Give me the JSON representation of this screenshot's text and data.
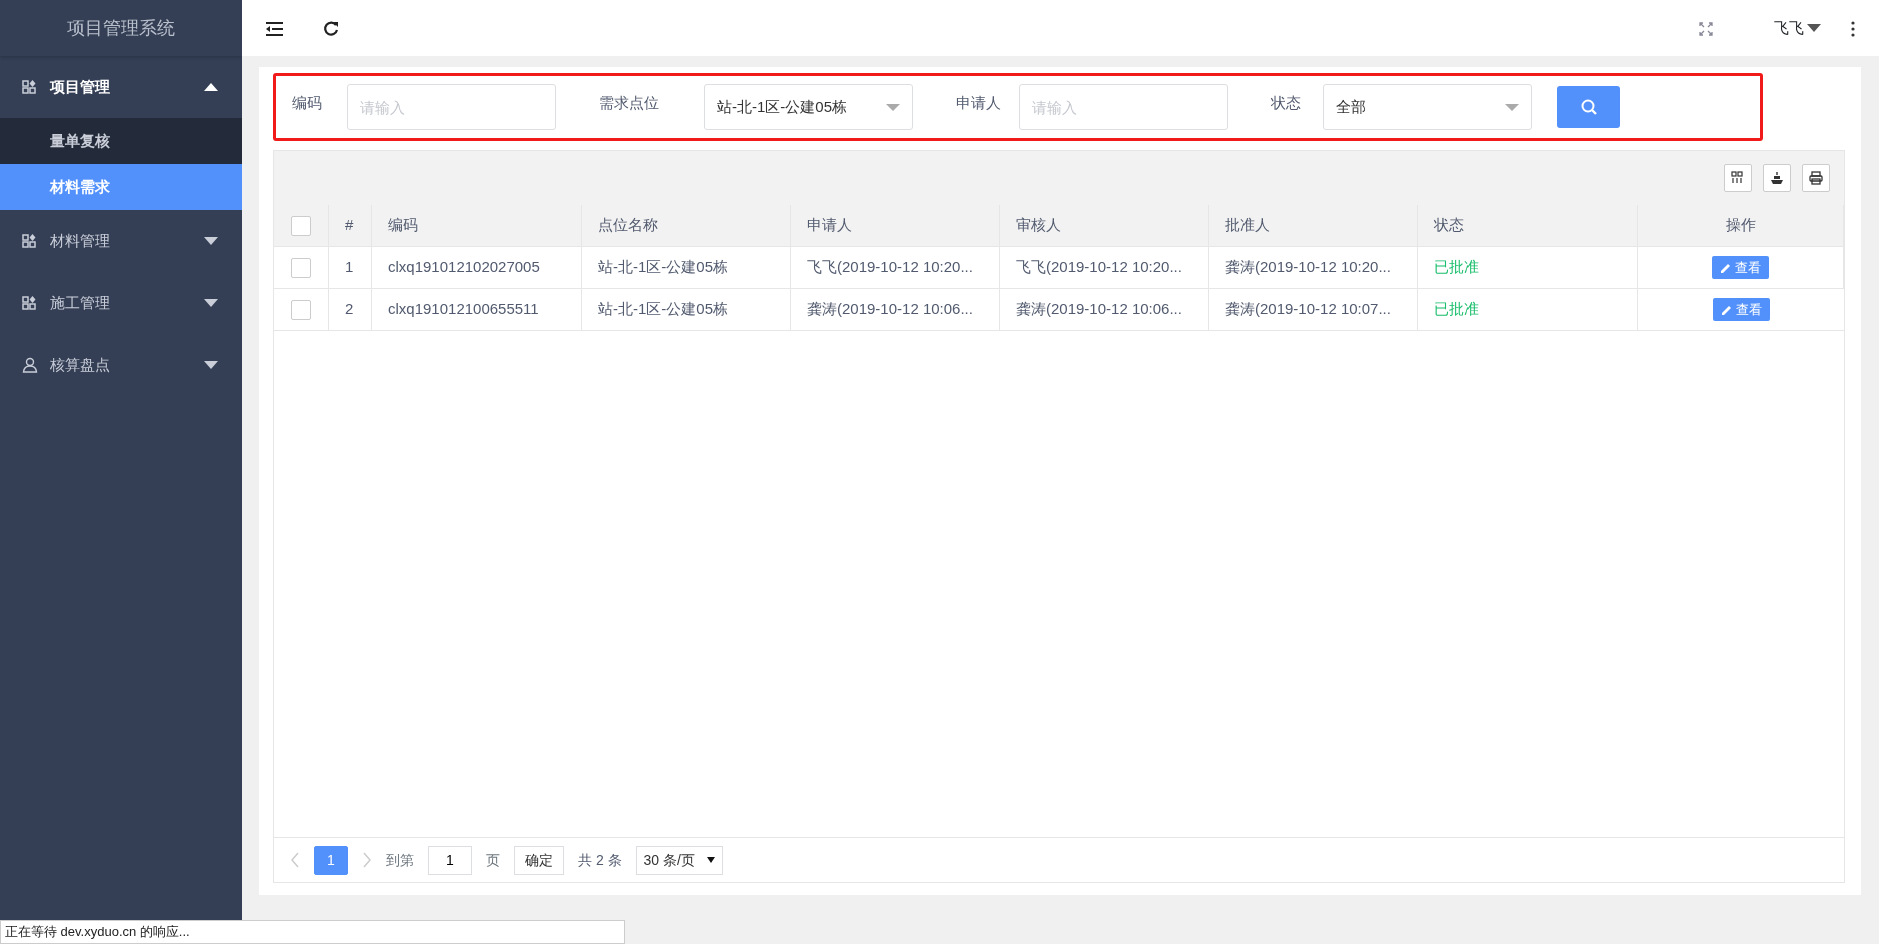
{
  "sidebar": {
    "title": "项目管理系统",
    "menu": [
      {
        "label": "项目管理",
        "kind": "module",
        "expanded": true,
        "children": [
          {
            "label": "量单复核",
            "selected": false
          },
          {
            "label": "材料需求",
            "selected": true
          }
        ]
      },
      {
        "label": "材料管理",
        "kind": "module",
        "expanded": false
      },
      {
        "label": "施工管理",
        "kind": "module",
        "expanded": false
      },
      {
        "label": "核算盘点",
        "kind": "person",
        "expanded": false
      }
    ]
  },
  "topbar": {
    "user": "飞飞"
  },
  "filters": [
    {
      "kind": "input",
      "label": "编码",
      "placeholder": "请输入"
    },
    {
      "kind": "select",
      "label": "需求点位",
      "value": "站-北-1区-公建05栋"
    },
    {
      "kind": "input",
      "label": "申请人",
      "placeholder": "请输入"
    },
    {
      "kind": "select",
      "label": "状态",
      "value": "全部"
    }
  ],
  "table": {
    "all_checked": false,
    "columns": [
      "#",
      "编码",
      "点位名称",
      "申请人",
      "审核人",
      "批准人",
      "状态",
      "操作"
    ],
    "rows": [
      {
        "checked": false,
        "cells": [
          "1",
          "clxq191012102027005",
          "站-北-1区-公建05栋",
          "飞飞(2019-10-12 10:20...",
          "飞飞(2019-10-12 10:20...",
          "龚涛(2019-10-12 10:20...",
          "已批准"
        ],
        "action": "查看"
      },
      {
        "checked": false,
        "cells": [
          "2",
          "clxq191012100655511",
          "站-北-1区-公建05栋",
          "龚涛(2019-10-12 10:06...",
          "龚涛(2019-10-12 10:06...",
          "龚涛(2019-10-12 10:07...",
          "已批准"
        ],
        "action": "查看"
      }
    ]
  },
  "pagination": {
    "pages": [
      {
        "label": "1",
        "selected": true
      }
    ],
    "goto_label": "到第",
    "goto_value": "1",
    "page_unit": "页",
    "confirm": "确定",
    "total": "共 2 条",
    "page_size": "30 条/页"
  },
  "browser_status": "正在等待 dev.xyduo.cn 的响应..."
}
